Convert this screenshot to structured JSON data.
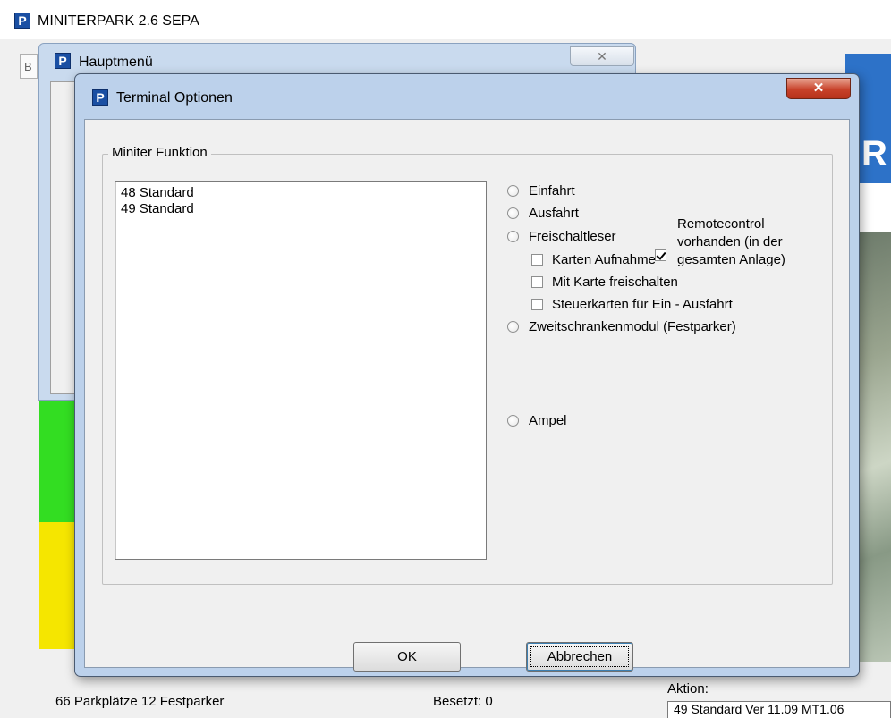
{
  "main_window": {
    "title": "MINITERPARK 2.6  SEPA",
    "tab_stub": "B",
    "right_pane_letter": "R",
    "status": {
      "parking": "66 Parkplätze  12 Festparker",
      "occupied": "Besetzt:  0",
      "action_label": "Aktion:",
      "action_value": "49 Standard Ver 11.09 MT1.06"
    },
    "status_colors": [
      "#33dd22",
      "#33dd22",
      "#f5e600",
      "#f5e600"
    ]
  },
  "menu_window": {
    "title": "Hauptmenü",
    "close_glyph": "✕"
  },
  "dialog": {
    "title": "Terminal Optionen",
    "close_glyph": "✕",
    "group_label": "Miniter Funktion",
    "terminals": [
      "48 Standard",
      "49 Standard"
    ],
    "options": {
      "einfahrt": "Einfahrt",
      "ausfahrt": "Ausfahrt",
      "freischaltleser": "Freischaltleser",
      "karten_aufnahme": "Karten Aufnahme",
      "mit_karte_freischalten": "Mit Karte freischalten",
      "steuerkarten": "Steuerkarten für Ein - Ausfahrt",
      "zweitschranken": "Zweitschrankenmodul (Festparker)",
      "ampel": "Ampel",
      "remotecontrol_line1": "Remotecontrol",
      "remotecontrol_line2": "vorhanden (in der",
      "remotecontrol_line3": "gesamten Anlage)"
    },
    "remotecontrol_checked": true,
    "buttons": {
      "ok": "OK",
      "cancel": "Abbrechen"
    }
  },
  "icons": {
    "app_icon_glyph": "P"
  }
}
